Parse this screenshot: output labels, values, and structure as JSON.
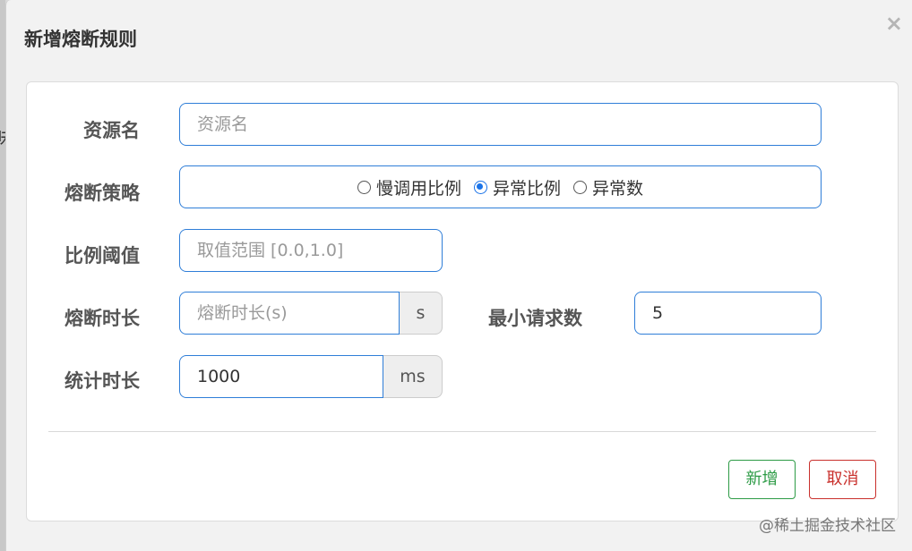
{
  "backdrop": {
    "edge_char": "味"
  },
  "dialog": {
    "title": "新增熔断规则",
    "close_glyph": "×"
  },
  "form": {
    "resource": {
      "label": "资源名",
      "placeholder": "资源名"
    },
    "strategy": {
      "label": "熔断策略",
      "options": [
        "慢调用比例",
        "异常比例",
        "异常数"
      ],
      "selected": "异常比例"
    },
    "ratio_threshold": {
      "label": "比例阈值",
      "placeholder": "取值范围 [0.0,1.0]"
    },
    "break_duration": {
      "label": "熔断时长",
      "placeholder": "熔断时长(s)",
      "unit": "s"
    },
    "min_requests": {
      "label": "最小请求数",
      "value": "5"
    },
    "stat_duration": {
      "label": "统计时长",
      "value": "1000",
      "unit": "ms"
    }
  },
  "footer": {
    "add_label": "新增",
    "cancel_label": "取消"
  },
  "watermark": "@稀土掘金技术社区",
  "colors": {
    "input_border": "#2f7ed8",
    "add_button": "#2d9b46",
    "cancel_button": "#c9302c",
    "radio_checked": "#1a73e8"
  }
}
